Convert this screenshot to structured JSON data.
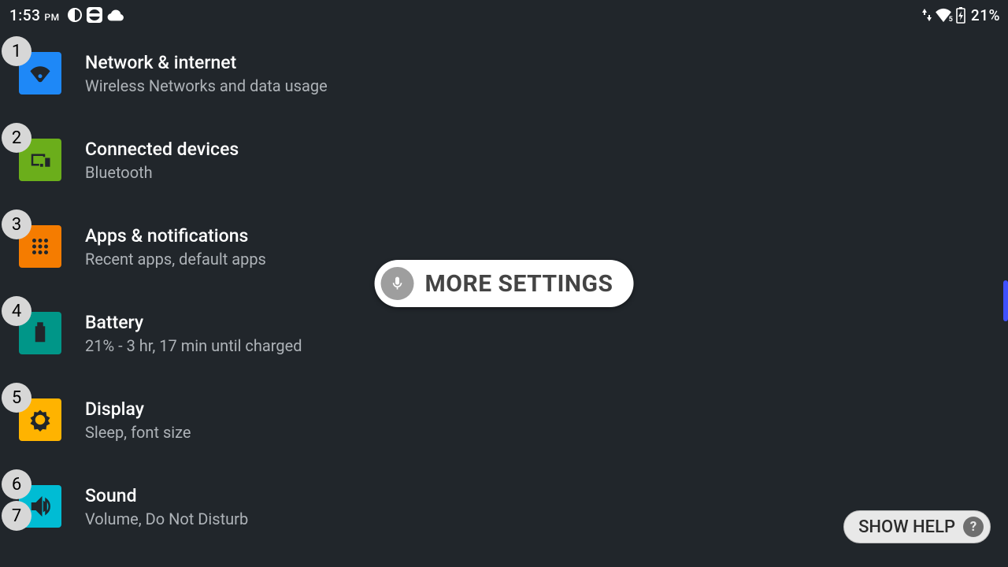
{
  "status": {
    "time": "1:53",
    "ampm": "PM",
    "battery_pct": "21%",
    "wifi_label": "5"
  },
  "settings": [
    {
      "badge": "1",
      "color": "c-blue",
      "icon": "wifi",
      "title": "Network & internet",
      "sub": "Wireless Networks and data usage"
    },
    {
      "badge": "2",
      "color": "c-green",
      "icon": "devices",
      "title": "Connected devices",
      "sub": "Bluetooth"
    },
    {
      "badge": "3",
      "color": "c-orange",
      "icon": "apps",
      "title": "Apps & notifications",
      "sub": "Recent apps, default apps"
    },
    {
      "badge": "4",
      "color": "c-teal",
      "icon": "battery",
      "title": "Battery",
      "sub": "21% - 3 hr, 17 min until charged"
    },
    {
      "badge": "5",
      "color": "c-amber",
      "icon": "brightness",
      "title": "Display",
      "sub": "Sleep, font size"
    },
    {
      "badge": "6",
      "color": "c-cyan",
      "icon": "volume",
      "title": "Sound",
      "sub": "Volume, Do Not Disturb",
      "badge2": "7"
    }
  ],
  "toast": {
    "label": "MORE SETTINGS"
  },
  "help": {
    "label": "SHOW HELP",
    "q": "?"
  }
}
